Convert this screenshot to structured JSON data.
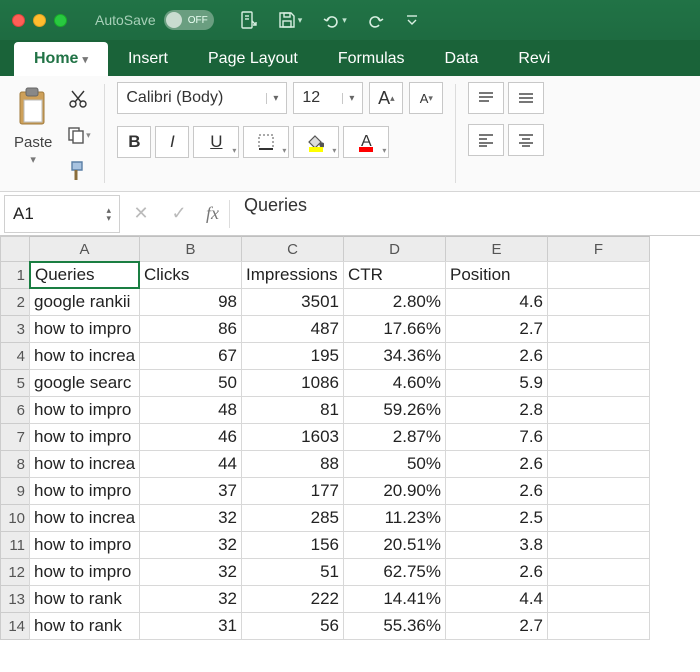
{
  "titlebar": {
    "autosave_label": "AutoSave",
    "autosave_state": "OFF"
  },
  "tabs": {
    "home": "Home",
    "insert": "Insert",
    "page_layout": "Page Layout",
    "formulas": "Formulas",
    "data": "Data",
    "review": "Revi"
  },
  "ribbon": {
    "paste_label": "Paste",
    "font_name": "Calibri (Body)",
    "font_size": "12",
    "bold": "B",
    "italic": "I",
    "underline": "U",
    "grow_font": "A",
    "shrink_font": "A",
    "font_color_letter": "A",
    "fill_letter": "A"
  },
  "namebox": {
    "ref": "A1"
  },
  "formula_bar": {
    "fx_label": "fx",
    "value": "Queries"
  },
  "sheet": {
    "col_headers": [
      "A",
      "B",
      "C",
      "D",
      "E",
      "F"
    ],
    "row_headers": [
      1,
      2,
      3,
      4,
      5,
      6,
      7,
      8,
      9,
      10,
      11,
      12,
      13,
      14
    ],
    "headers": {
      "A": "Queries",
      "B": "Clicks",
      "C": "Impressions",
      "D": "CTR",
      "E": "Position"
    },
    "rows": [
      {
        "A": "google rankii",
        "B": "98",
        "C": "3501",
        "D": "2.80%",
        "E": "4.6"
      },
      {
        "A": "how to impro",
        "B": "86",
        "C": "487",
        "D": "17.66%",
        "E": "2.7"
      },
      {
        "A": "how to increa",
        "B": "67",
        "C": "195",
        "D": "34.36%",
        "E": "2.6"
      },
      {
        "A": "google searc",
        "B": "50",
        "C": "1086",
        "D": "4.60%",
        "E": "5.9"
      },
      {
        "A": "how to impro",
        "B": "48",
        "C": "81",
        "D": "59.26%",
        "E": "2.8"
      },
      {
        "A": "how to impro",
        "B": "46",
        "C": "1603",
        "D": "2.87%",
        "E": "7.6"
      },
      {
        "A": "how to increa",
        "B": "44",
        "C": "88",
        "D": "50%",
        "E": "2.6"
      },
      {
        "A": "how to impro",
        "B": "37",
        "C": "177",
        "D": "20.90%",
        "E": "2.6"
      },
      {
        "A": "how to increa",
        "B": "32",
        "C": "285",
        "D": "11.23%",
        "E": "2.5"
      },
      {
        "A": "how to impro",
        "B": "32",
        "C": "156",
        "D": "20.51%",
        "E": "3.8"
      },
      {
        "A": "how to impro",
        "B": "32",
        "C": "51",
        "D": "62.75%",
        "E": "2.6"
      },
      {
        "A": "how to rank",
        "B": "32",
        "C": "222",
        "D": "14.41%",
        "E": "4.4"
      },
      {
        "A": "how to rank",
        "B": "31",
        "C": "56",
        "D": "55.36%",
        "E": "2.7"
      }
    ]
  }
}
